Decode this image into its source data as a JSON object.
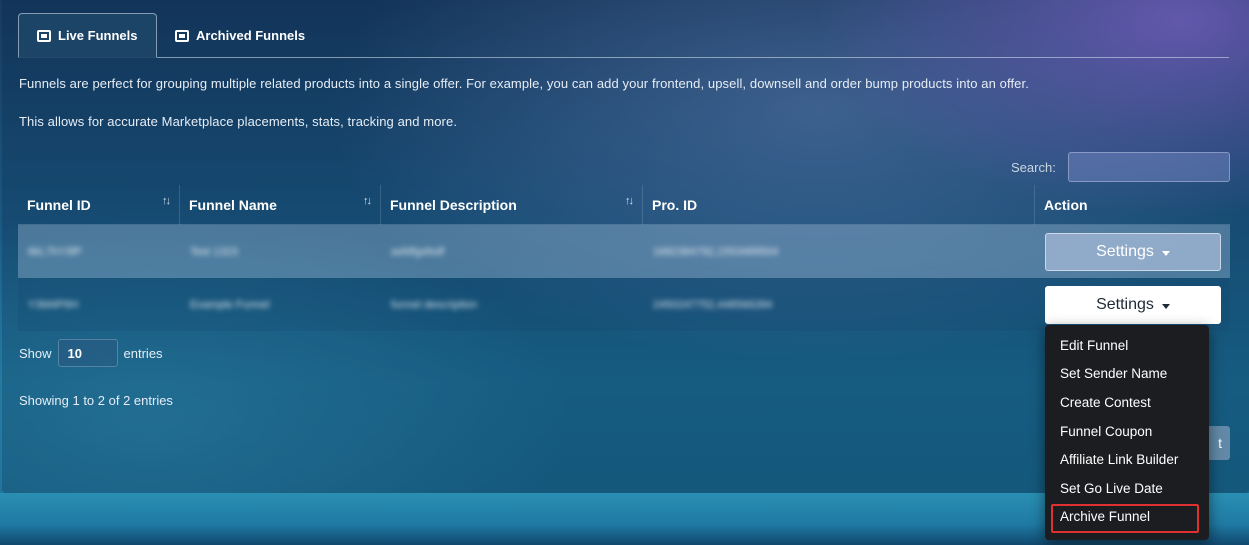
{
  "tabs": {
    "live": "Live Funnels",
    "archived": "Archived Funnels"
  },
  "intro": {
    "line1": "Funnels are perfect for grouping multiple related products into a single offer. For example, you can add your frontend, upsell, downsell and order bump products into an offer.",
    "line2": "This allows for accurate Marketplace placements, stats, tracking and more."
  },
  "search": {
    "label": "Search:",
    "value": ""
  },
  "table": {
    "columns": [
      "Funnel ID",
      "Funnel Name",
      "Funnel Description",
      "Pro. ID",
      "Action"
    ],
    "sort_glyph": "↑↓",
    "rows": [
      {
        "funnel_id": "6kL7hY3fP",
        "funnel_name": "Test 1323",
        "funnel_description": "asfdfgsfsdf",
        "pro_id": "1682384792,1553489504",
        "action": "Settings"
      },
      {
        "funnel_id": "Y3M4P6H",
        "funnel_name": "Example Funnel",
        "funnel_description": "funnel description",
        "pro_id": "2450247752,448566284",
        "action": "Settings"
      }
    ]
  },
  "length": {
    "show": "Show",
    "value": "10",
    "entries": "entries"
  },
  "info": "Showing 1 to 2 of 2 entries",
  "pagination": {
    "next_partial": "t"
  },
  "dropdown": {
    "items": [
      "Edit Funnel",
      "Set Sender Name",
      "Create Contest",
      "Funnel Coupon",
      "Affiliate Link Builder",
      "Set Go Live Date",
      "Archive Funnel"
    ],
    "highlighted": "Archive Funnel",
    "highlight_color": "#e03131"
  }
}
